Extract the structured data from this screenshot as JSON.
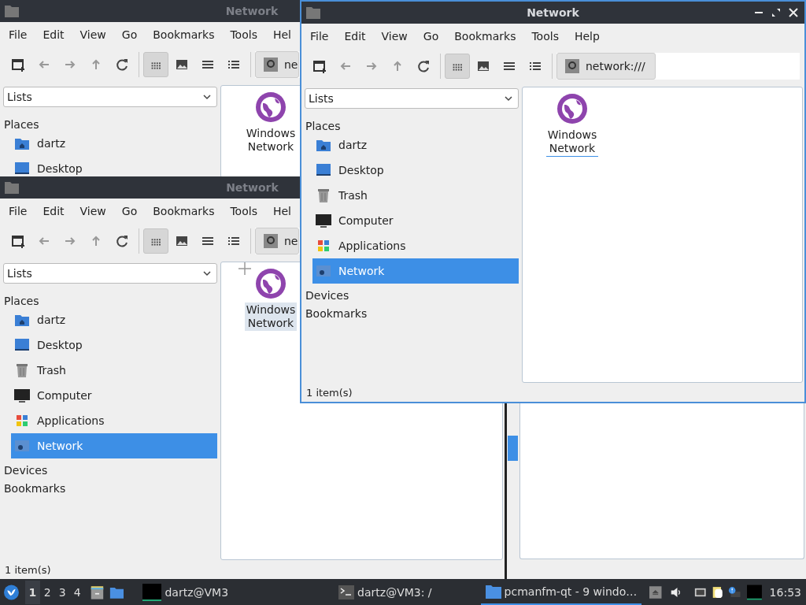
{
  "windows": [
    {
      "title": "Network",
      "active": false,
      "menu": [
        "File",
        "Edit",
        "View",
        "Go",
        "Bookmarks",
        "Tools",
        "Hel"
      ],
      "view_buttons": [
        {
          "selected": true
        },
        {
          "selected": false
        },
        {
          "selected": false
        },
        {
          "selected": false
        }
      ],
      "path": "ne",
      "sidebar": {
        "combo": "Lists",
        "sections": [
          {
            "label": "Places",
            "items": [
              {
                "label": "dartz",
                "kind": "home",
                "selected": false
              },
              {
                "label": "Desktop",
                "kind": "desktop",
                "selected": false
              }
            ]
          }
        ]
      },
      "files": [
        {
          "label": "Windows Network",
          "selected": false,
          "focused": false
        }
      ]
    },
    {
      "title": "Network",
      "active": false,
      "menu": [
        "File",
        "Edit",
        "View",
        "Go",
        "Bookmarks",
        "Tools",
        "Hel"
      ],
      "view_buttons": [
        {
          "selected": true
        },
        {
          "selected": false
        },
        {
          "selected": false
        },
        {
          "selected": false
        }
      ],
      "path": "ne",
      "sidebar": {
        "combo": "Lists",
        "sections": [
          {
            "label": "Places",
            "items": [
              {
                "label": "dartz",
                "kind": "home",
                "selected": false
              },
              {
                "label": "Desktop",
                "kind": "desktop",
                "selected": false
              },
              {
                "label": "Trash",
                "kind": "trash",
                "selected": false
              },
              {
                "label": "Computer",
                "kind": "computer",
                "selected": false
              },
              {
                "label": "Applications",
                "kind": "apps",
                "selected": false
              },
              {
                "label": "Network",
                "kind": "network",
                "selected": true
              }
            ]
          },
          {
            "label": "Devices"
          },
          {
            "label": "Bookmarks"
          }
        ]
      },
      "files": [
        {
          "label": "Windows Network",
          "selected": true,
          "focused": false
        }
      ],
      "status": "1 item(s)"
    },
    {
      "title": "Network",
      "active": true,
      "menu": [
        "File",
        "Edit",
        "View",
        "Go",
        "Bookmarks",
        "Tools",
        "Help"
      ],
      "view_buttons": [
        {
          "selected": true
        },
        {
          "selected": false
        },
        {
          "selected": false
        },
        {
          "selected": false
        }
      ],
      "path": "network:///",
      "sidebar": {
        "combo": "Lists",
        "sections": [
          {
            "label": "Places",
            "items": [
              {
                "label": "dartz",
                "kind": "home",
                "selected": false
              },
              {
                "label": "Desktop",
                "kind": "desktop",
                "selected": false
              },
              {
                "label": "Trash",
                "kind": "trash",
                "selected": false
              },
              {
                "label": "Computer",
                "kind": "computer",
                "selected": false
              },
              {
                "label": "Applications",
                "kind": "apps",
                "selected": false
              },
              {
                "label": "Network",
                "kind": "network",
                "selected": true
              }
            ]
          },
          {
            "label": "Devices"
          },
          {
            "label": "Bookmarks"
          }
        ]
      },
      "files": [
        {
          "label": "Windows Network",
          "selected": false,
          "focused": true
        }
      ],
      "status": "1 item(s)"
    }
  ],
  "taskbar": {
    "workspaces": [
      {
        "label": "1",
        "selected": true
      },
      {
        "label": "2",
        "selected": false
      },
      {
        "label": "3",
        "selected": false
      },
      {
        "label": "4",
        "selected": false
      }
    ],
    "tasks": [
      {
        "label": "dartz@VM3",
        "kind": "thumbnail",
        "selected": false
      },
      {
        "label": "dartz@VM3: /",
        "kind": "terminal",
        "selected": false
      },
      {
        "label": "pcmanfm-qt - 9 windo…",
        "kind": "folder",
        "selected": true
      }
    ],
    "clock": "16:53"
  }
}
